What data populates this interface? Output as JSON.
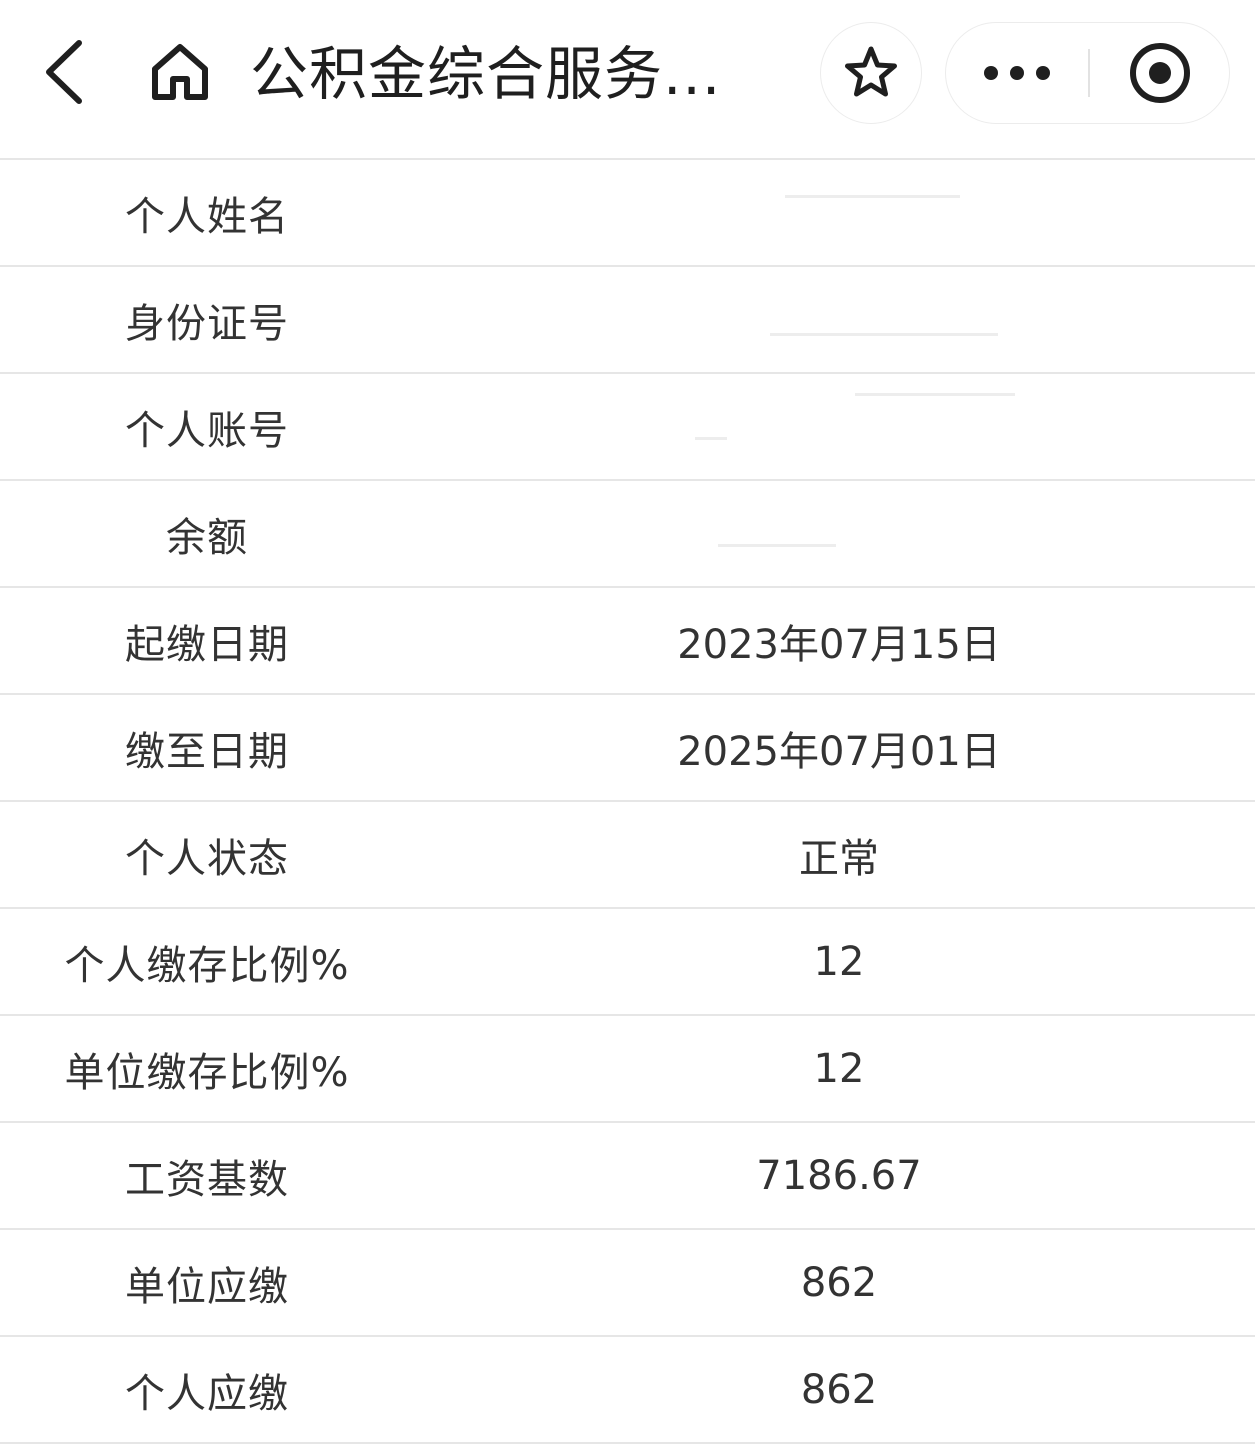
{
  "nav": {
    "title": "公积金综合服务...",
    "icons": {
      "back": "chevron-left-icon",
      "home": "home-icon",
      "favorite": "star-icon",
      "more": "more-dots-icon",
      "close": "target-circle-icon"
    }
  },
  "table": {
    "rows": [
      {
        "label": "个人姓名",
        "value": ""
      },
      {
        "label": "身份证号",
        "value": ""
      },
      {
        "label": "个人账号",
        "value": ""
      },
      {
        "label": "余额",
        "value": ""
      },
      {
        "label": "起缴日期",
        "value": "2023年07月15日"
      },
      {
        "label": "缴至日期",
        "value": "2025年07月01日"
      },
      {
        "label": "个人状态",
        "value": "正常"
      },
      {
        "label": "个人缴存比例%",
        "value": "12"
      },
      {
        "label": "单位缴存比例%",
        "value": "12"
      },
      {
        "label": "工资基数",
        "value": "7186.67"
      },
      {
        "label": "单位应缴",
        "value": "862"
      },
      {
        "label": "个人应缴",
        "value": "862"
      }
    ]
  }
}
